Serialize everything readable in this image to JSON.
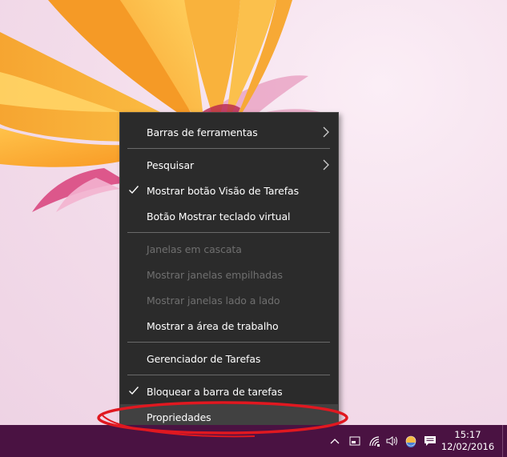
{
  "context_menu": {
    "items": [
      {
        "label": "Barras de ferramentas",
        "submenu": true
      },
      {
        "label": "Pesquisar",
        "submenu": true
      },
      {
        "label": "Mostrar botão Visão de Tarefas",
        "checked": true
      },
      {
        "label": "Botão Mostrar teclado virtual"
      },
      {
        "label": "Janelas em cascata",
        "disabled": true
      },
      {
        "label": "Mostrar janelas empilhadas",
        "disabled": true
      },
      {
        "label": "Mostrar janelas lado a lado",
        "disabled": true
      },
      {
        "label": "Mostrar a área de trabalho"
      },
      {
        "label": "Gerenciador de Tarefas"
      },
      {
        "label": "Bloquear a barra de tarefas",
        "checked": true
      },
      {
        "label": "Propriedades",
        "highlighted": true
      }
    ]
  },
  "taskbar": {
    "color": "#4a1242",
    "tray_icons": [
      "chevron-up-icon",
      "input-indicator-icon",
      "wifi-icon",
      "volume-icon",
      "weather-icon",
      "action-center-icon"
    ],
    "clock": {
      "time": "15:17",
      "date": "12/02/2016"
    }
  },
  "annotation_color": "#e01820"
}
